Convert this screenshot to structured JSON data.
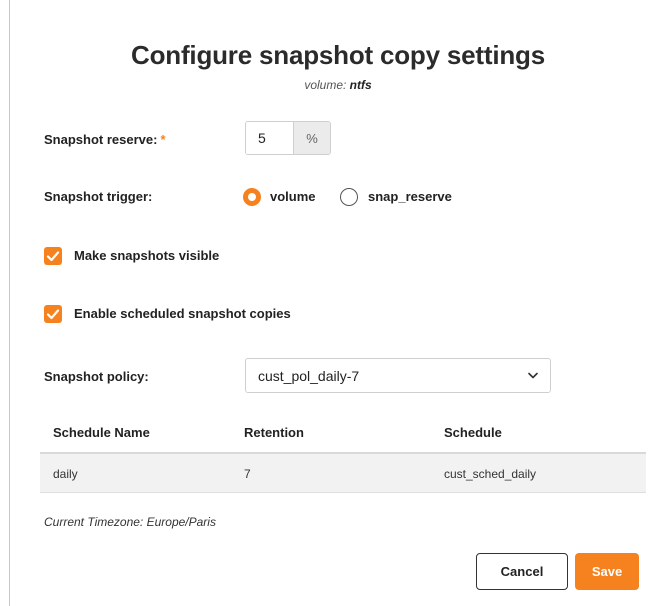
{
  "dialog": {
    "title": "Configure snapshot copy settings",
    "subtitle_prefix": "volume: ",
    "subtitle_value": "ntfs"
  },
  "reserve": {
    "label": "Snapshot reserve:",
    "required_mark": "*",
    "value": "5",
    "unit": "%"
  },
  "trigger": {
    "label": "Snapshot trigger:",
    "options": [
      {
        "label": "volume",
        "selected": true
      },
      {
        "label": "snap_reserve",
        "selected": false
      }
    ]
  },
  "visible_checkbox": {
    "label": "Make snapshots visible",
    "checked": true
  },
  "scheduled_checkbox": {
    "label": "Enable scheduled snapshot copies",
    "checked": true
  },
  "policy": {
    "label": "Snapshot policy:",
    "selected": "cust_pol_daily-7"
  },
  "schedule_table": {
    "columns": [
      "Schedule Name",
      "Retention",
      "Schedule"
    ],
    "rows": [
      {
        "name": "daily",
        "retention": "7",
        "schedule": "cust_sched_daily"
      }
    ]
  },
  "timezone": "Current Timezone: Europe/Paris",
  "buttons": {
    "cancel": "Cancel",
    "save": "Save"
  },
  "colors": {
    "accent": "#f5821f"
  }
}
